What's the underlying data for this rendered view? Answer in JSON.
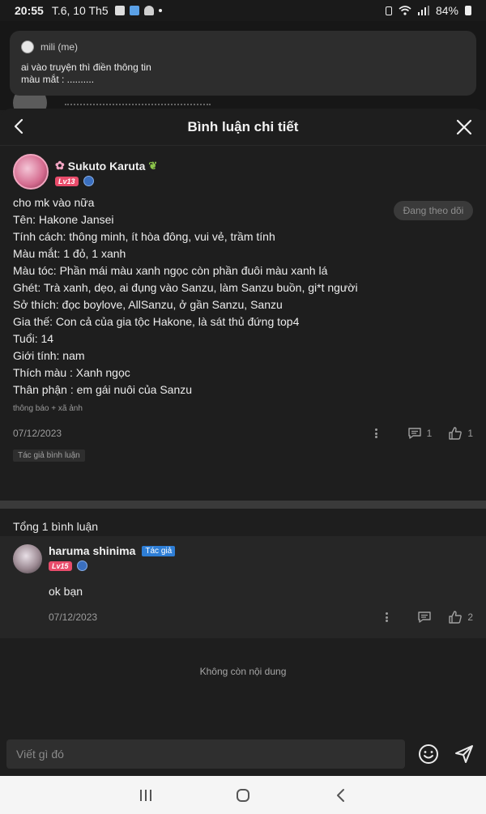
{
  "status_bar": {
    "time": "20:55",
    "date": "T.6, 10 Th5",
    "battery": "84%"
  },
  "notification": {
    "sender": "mili (me)",
    "line1": "ai vào truyện thì điền thông tin",
    "line2": "màu mắt : .........."
  },
  "header": {
    "title": "Bình luận chi tiết"
  },
  "post": {
    "author_name": "Sukuto Karuta",
    "author_level": "Lv13",
    "follow_label": "Đang theo dõi",
    "lines": [
      "cho mk vào nữa",
      "Tên: Hakone Jansei",
      "Tính cách: thông minh, ít hòa đông, vui vẻ, trầm tính",
      "Màu mắt: 1 đỏ, 1 xanh",
      "Màu tóc: Phần mái màu xanh ngọc còn phần đuôi màu xanh lá",
      "Ghét: Trà xanh, dẹo,  ai đụng vào Sanzu, làm Sanzu buồn, gi*t người",
      "Sở thích: đọc boylove, AllSanzu, ở gần Sanzu, Sanzu",
      "Gia thế: Con cả của gia tộc Hakone, là sát thủ đứng top4",
      "Tuổi: 14",
      "Giới tính: nam",
      "Thích màu : Xanh ngọc",
      "Thân phận : em gái nuôi của Sanzu"
    ],
    "note": "thông báo + xã ảnh",
    "date": "07/12/2023",
    "comment_count": "1",
    "like_count": "1",
    "tag": "Tác giả bình luận"
  },
  "comments": {
    "total_label": "Tổng 1 bình luận",
    "items": [
      {
        "name": "haruma shinima",
        "author_tag": "Tác giả",
        "level": "Lv15",
        "text": "ok bạn",
        "date": "07/12/2023",
        "like_count": "2"
      }
    ],
    "end_label": "Không còn nội dung"
  },
  "composer": {
    "placeholder": "Viết gì đó"
  },
  "colors": {
    "background": "#1e1e1e",
    "level_badge": "#e94c6b",
    "author_tag": "#2e7ed6"
  }
}
